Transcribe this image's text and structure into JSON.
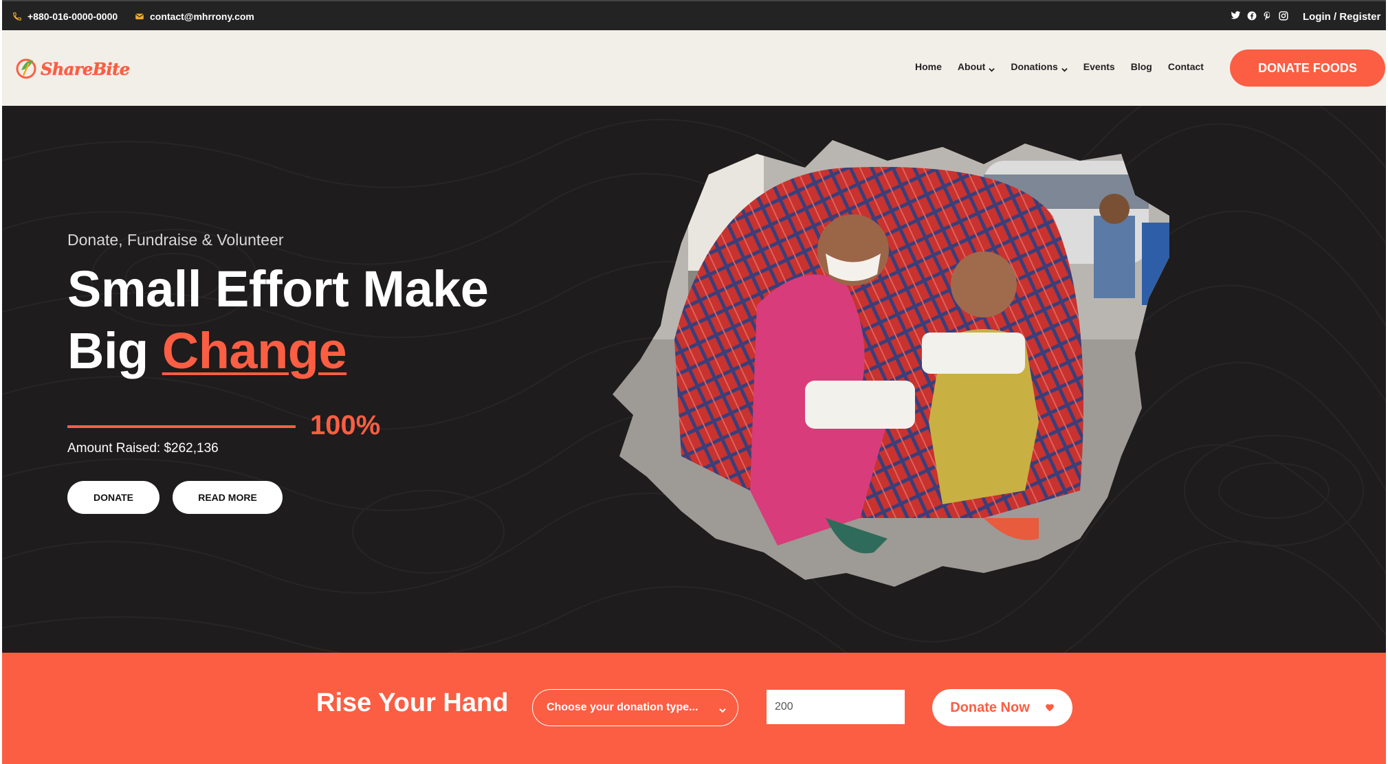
{
  "topbar": {
    "phone": "+880-016-0000-0000",
    "email": "contact@mhrrony.com",
    "social_icons": [
      "twitter-icon",
      "facebook-icon",
      "pinterest-icon",
      "instagram-icon"
    ],
    "login_label": "Login / Register"
  },
  "nav": {
    "logo_text": "ShareBite",
    "items": [
      {
        "label": "Home",
        "dropdown": false
      },
      {
        "label": "About",
        "dropdown": true
      },
      {
        "label": "Donations",
        "dropdown": true
      },
      {
        "label": "Events",
        "dropdown": false
      },
      {
        "label": "Blog",
        "dropdown": false
      },
      {
        "label": "Contact",
        "dropdown": false
      }
    ],
    "cta_label": "DONATE FOODS"
  },
  "hero": {
    "kicker": "Donate, Fundraise & Volunteer",
    "title_line1": "Small Effort Make",
    "title_line2_plain": "Big",
    "title_line2_accent": "Change",
    "progress_percent": 100,
    "progress_label": "100%",
    "amount_raised": "Amount Raised: $262,136",
    "donate_label": "DONATE",
    "read_more_label": "READ MORE"
  },
  "donation_strip": {
    "title": "Rise Your Hand",
    "select_value": "Choose your donation type...",
    "amount_value": "200",
    "button_label": "Donate Now",
    "button_icon": "heart-icon"
  },
  "colors": {
    "accent": "#fb5e43",
    "dark": "#1e1c1c",
    "topbar": "#232323",
    "nav_bg": "#f2efe9"
  }
}
